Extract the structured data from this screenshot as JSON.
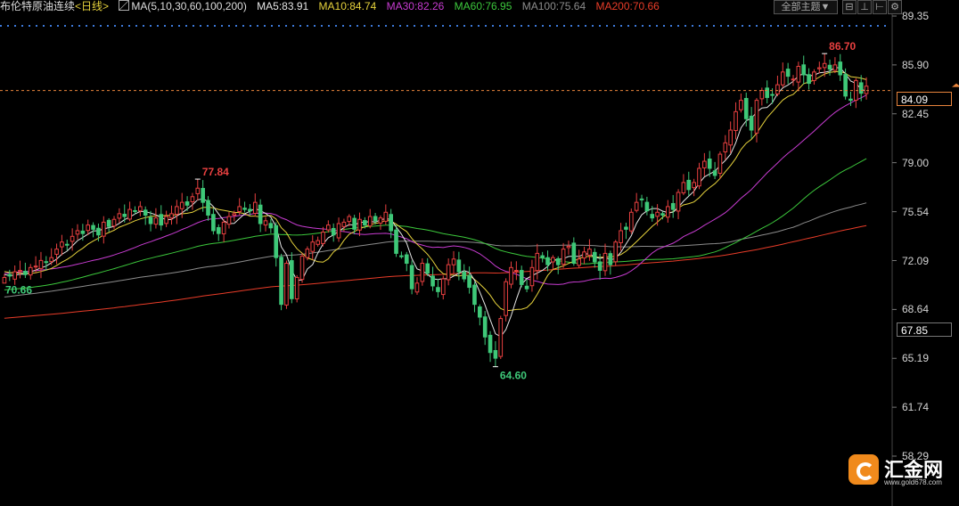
{
  "header": {
    "instrument": "布伦特原油连续",
    "period": "<日线>",
    "ma_label": "MA(5,10,30,60,100,200)",
    "ma5": "MA5:83.91",
    "ma10": "MA10:84.74",
    "ma30": "MA30:82.26",
    "ma60": "MA60:76.95",
    "ma100": "MA100:75.64",
    "ma200": "MA200:70.66",
    "theme_select": "全部主题▼"
  },
  "colors": {
    "up": "#e84040",
    "down": "#3ec878",
    "ma5": "#e6e6e6",
    "ma10": "#e6d23c",
    "ma30": "#c83cd2",
    "ma60": "#3cc83c",
    "ma100": "#8c8c8c",
    "ma200": "#e83c28",
    "current_line": "#e8843c"
  },
  "icons": {
    "theme": "dropdown",
    "ctrl1": "window-restore-icon",
    "ctrl2": "align-bottom-icon",
    "ctrl3": "align-right-icon",
    "ctrl4": "settings-icon",
    "ma_icon": "indicator-icon"
  },
  "watermark": {
    "title": "汇金网",
    "url": "www.gold678.com"
  },
  "chart_data": {
    "type": "candlestick",
    "title": "布伦特原油连续<日线>",
    "y_ticks": [
      89.35,
      85.9,
      82.45,
      79.0,
      75.54,
      72.09,
      68.64,
      65.19,
      61.74,
      58.29
    ],
    "ylim": [
      58.29,
      89.35
    ],
    "grid": false,
    "current_price": "84.09",
    "marked_price": "67.85",
    "annotations": {
      "high_label": "86.70",
      "low_label": "64.60",
      "local_high_label": "77.84",
      "start_label": "70.66"
    },
    "closes": [
      70.9,
      71.0,
      71.3,
      71.4,
      71.1,
      71.6,
      71.7,
      72.1,
      72.0,
      72.3,
      72.9,
      73.4,
      73.2,
      73.8,
      74.2,
      74.0,
      74.6,
      74.3,
      73.9,
      74.8,
      74.5,
      75.0,
      75.4,
      75.2,
      75.7,
      75.6,
      75.9,
      75.3,
      74.7,
      75.1,
      74.6,
      75.2,
      75.4,
      75.9,
      76.2,
      76.0,
      76.6,
      77.2,
      76.2,
      75.3,
      74.2,
      74.0,
      74.8,
      75.2,
      75.4,
      75.9,
      75.7,
      75.6,
      76.2,
      74.7,
      74.9,
      74.4,
      72.3,
      69.0,
      71.9,
      69.4,
      70.9,
      72.4,
      72.9,
      73.4,
      73.5,
      74.1,
      74.6,
      73.9,
      74.7,
      74.8,
      75.2,
      74.3,
      75.0,
      74.6,
      75.2,
      74.9,
      75.1,
      75.5,
      74.2,
      72.6,
      72.4,
      71.9,
      70.1,
      70.5,
      71.9,
      71.2,
      70.3,
      69.9,
      70.8,
      71.8,
      72.2,
      71.3,
      70.8,
      70.2,
      69.0,
      68.1,
      66.7,
      65.6,
      65.2,
      68.0,
      70.6,
      71.6,
      71.4,
      70.4,
      70.1,
      71.6,
      72.6,
      72.3,
      71.8,
      72.3,
      71.8,
      72.9,
      73.1,
      71.9,
      72.2,
      72.7,
      72.9,
      72.0,
      71.4,
      72.6,
      71.8,
      73.4,
      74.2,
      74.3,
      75.5,
      76.2,
      76.4,
      75.6,
      75.1,
      75.5,
      75.3,
      75.9,
      75.7,
      76.9,
      77.6,
      77.1,
      77.6,
      78.6,
      79.1,
      78.6,
      78.1,
      79.6,
      80.4,
      81.3,
      82.6,
      83.4,
      82.1,
      81.3,
      83.4,
      84.1,
      83.6,
      83.8,
      84.5,
      85.4,
      85.1,
      84.9,
      85.8,
      85.2,
      84.6,
      85.4,
      85.7,
      86.0,
      85.6,
      85.9,
      85.2,
      83.7,
      83.4,
      84.8,
      83.9,
      84.4
    ]
  }
}
